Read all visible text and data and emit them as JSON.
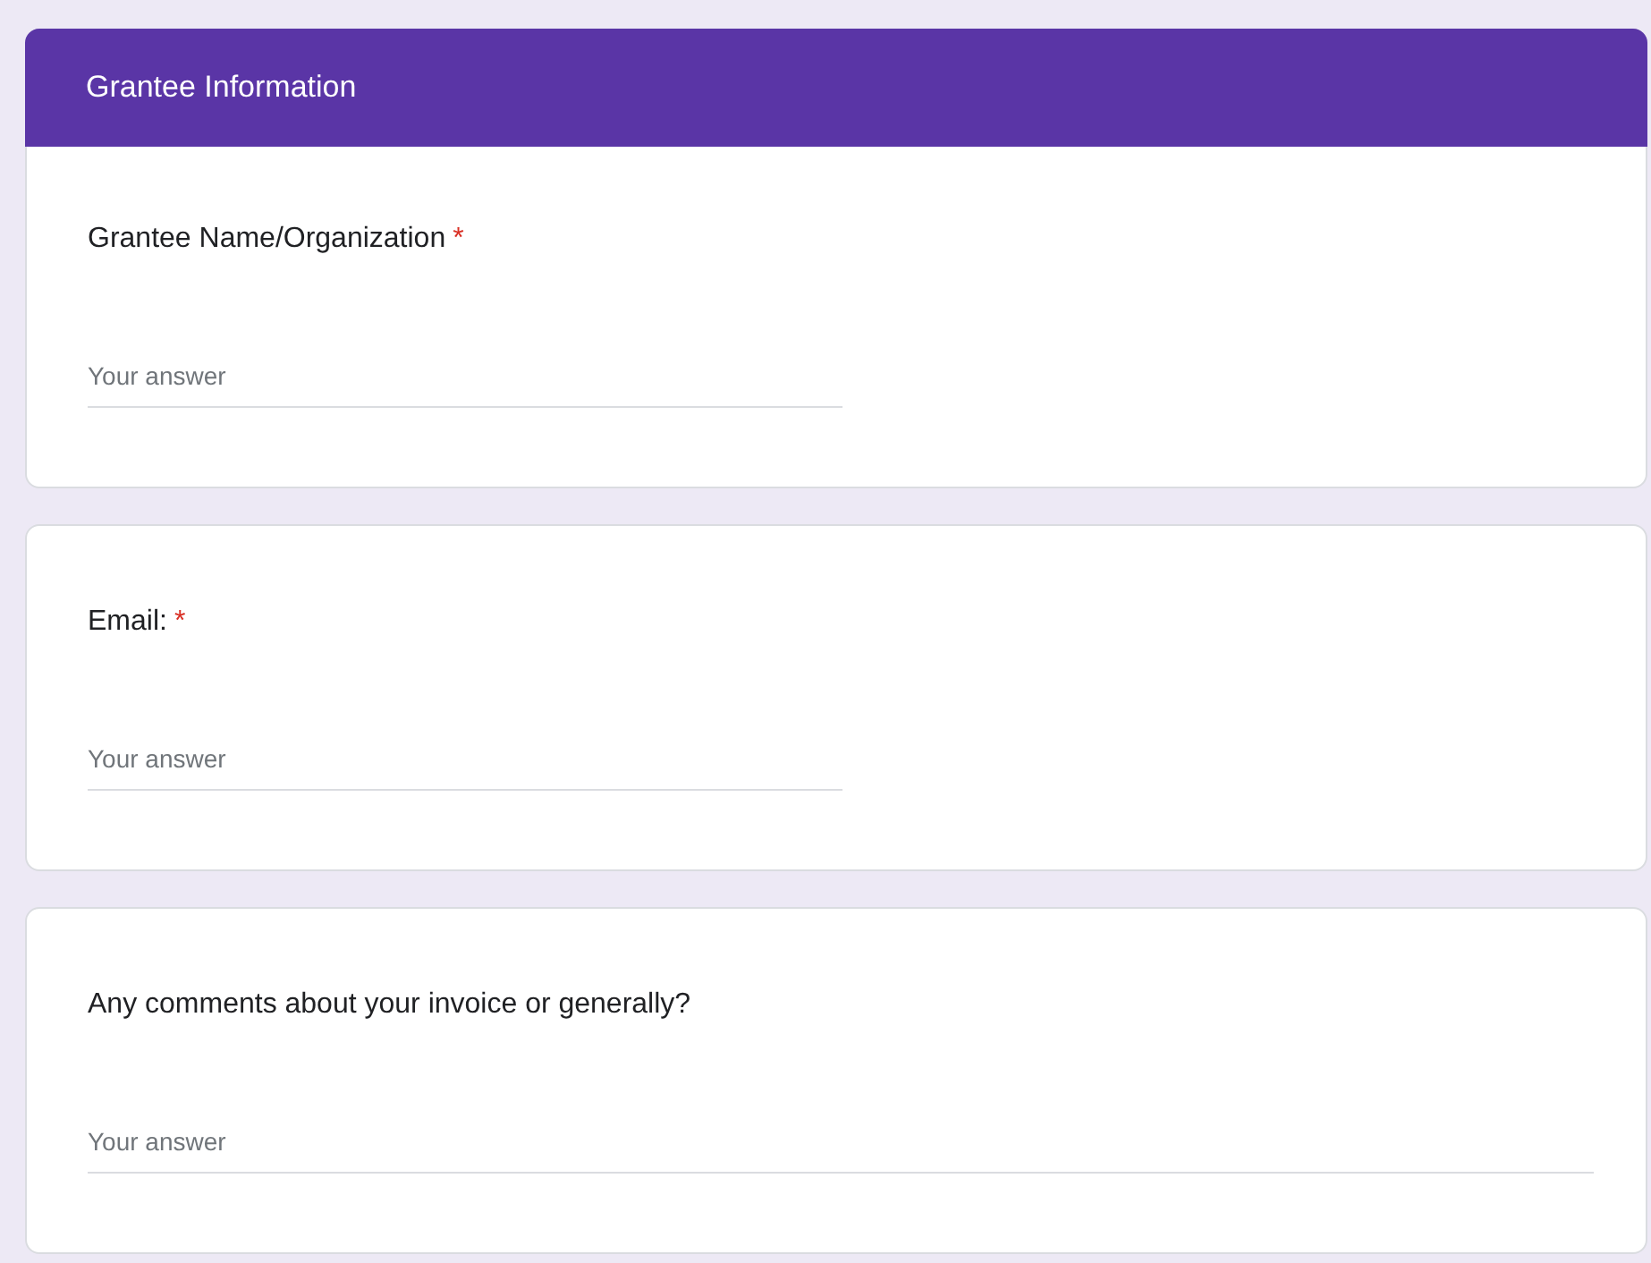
{
  "section": {
    "title": "Grantee Information"
  },
  "questions": [
    {
      "label": "Grantee Name/Organization",
      "required": true,
      "placeholder": "Your answer",
      "wide": false
    },
    {
      "label": "Email:",
      "required": true,
      "placeholder": "Your answer",
      "wide": false
    },
    {
      "label": "Any comments about your invoice or generally?",
      "required": false,
      "placeholder": "Your answer",
      "wide": true
    }
  ],
  "required_mark": "*"
}
